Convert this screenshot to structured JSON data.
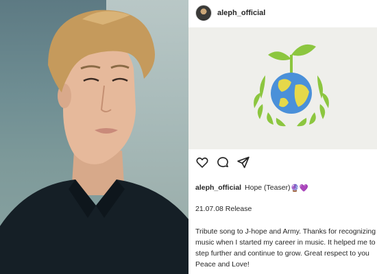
{
  "profile": {
    "username": "aleph_official"
  },
  "post": {
    "caption_username": "aleph_official",
    "caption_title": "Hope (Teaser)",
    "caption_emoji": "🔮💜",
    "release_line": "21.07.08 Release",
    "body_lines": [
      "Tribute song to J-hope and Army. Thanks for recognizing",
      "music when I started my career in music. It helped me to",
      "step further and continue to grow. Great respect to you",
      "Peace and Love!"
    ]
  },
  "icons": {
    "like": "heart-icon",
    "comment": "comment-icon",
    "share": "send-icon"
  },
  "colors": {
    "text": "#262626",
    "image_bg": "#efefeb",
    "leaf_green": "#8cc63f",
    "ocean_blue": "#4a90d9",
    "land_yellow": "#e6d84a"
  }
}
